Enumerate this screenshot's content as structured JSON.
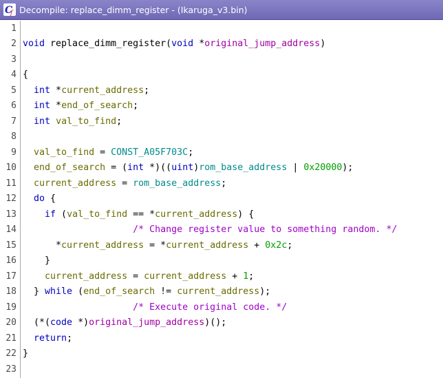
{
  "window": {
    "title": "Decompile: replace_dimm_register -  (Ikaruga_v3.bin)",
    "icon": "ghidra-decompile-icon"
  },
  "colors": {
    "titlebar": "#7a74c0",
    "keyword": "#0000c0",
    "parameter": "#a000a0",
    "local_variable": "#6a6a00",
    "global": "#008a8a",
    "constant": "#00a000",
    "comment": "#a000c8"
  },
  "code": {
    "lines": [
      {
        "num": "1",
        "tokens": []
      },
      {
        "num": "2",
        "tokens": [
          {
            "t": "kw",
            "v": "void"
          },
          {
            "t": "plain",
            "v": " replace_dimm_register("
          },
          {
            "t": "kw",
            "v": "void"
          },
          {
            "t": "plain",
            "v": " *"
          },
          {
            "t": "param",
            "v": "original_jump_address"
          },
          {
            "t": "plain",
            "v": ")"
          }
        ]
      },
      {
        "num": "3",
        "tokens": []
      },
      {
        "num": "4",
        "tokens": [
          {
            "t": "plain",
            "v": "{"
          }
        ]
      },
      {
        "num": "5",
        "tokens": [
          {
            "t": "plain",
            "v": "  "
          },
          {
            "t": "kw",
            "v": "int"
          },
          {
            "t": "plain",
            "v": " *"
          },
          {
            "t": "var",
            "v": "current_address"
          },
          {
            "t": "plain",
            "v": ";"
          }
        ]
      },
      {
        "num": "6",
        "tokens": [
          {
            "t": "plain",
            "v": "  "
          },
          {
            "t": "kw",
            "v": "int"
          },
          {
            "t": "plain",
            "v": " *"
          },
          {
            "t": "var",
            "v": "end_of_search"
          },
          {
            "t": "plain",
            "v": ";"
          }
        ]
      },
      {
        "num": "7",
        "tokens": [
          {
            "t": "plain",
            "v": "  "
          },
          {
            "t": "kw",
            "v": "int"
          },
          {
            "t": "plain",
            "v": " "
          },
          {
            "t": "var",
            "v": "val_to_find"
          },
          {
            "t": "plain",
            "v": ";"
          }
        ]
      },
      {
        "num": "8",
        "tokens": []
      },
      {
        "num": "9",
        "tokens": [
          {
            "t": "plain",
            "v": "  "
          },
          {
            "t": "var",
            "v": "val_to_find"
          },
          {
            "t": "plain",
            "v": " = "
          },
          {
            "t": "glob",
            "v": "CONST_A05F703C"
          },
          {
            "t": "plain",
            "v": ";"
          }
        ]
      },
      {
        "num": "10",
        "tokens": [
          {
            "t": "plain",
            "v": "  "
          },
          {
            "t": "var",
            "v": "end_of_search"
          },
          {
            "t": "plain",
            "v": " = ("
          },
          {
            "t": "kw",
            "v": "int"
          },
          {
            "t": "plain",
            "v": " *)(("
          },
          {
            "t": "kw",
            "v": "uint"
          },
          {
            "t": "plain",
            "v": ")"
          },
          {
            "t": "glob",
            "v": "rom_base_address"
          },
          {
            "t": "plain",
            "v": " | "
          },
          {
            "t": "num",
            "v": "0x20000"
          },
          {
            "t": "plain",
            "v": ");"
          }
        ]
      },
      {
        "num": "11",
        "tokens": [
          {
            "t": "plain",
            "v": "  "
          },
          {
            "t": "var",
            "v": "current_address"
          },
          {
            "t": "plain",
            "v": " = "
          },
          {
            "t": "glob",
            "v": "rom_base_address"
          },
          {
            "t": "plain",
            "v": ";"
          }
        ]
      },
      {
        "num": "12",
        "tokens": [
          {
            "t": "plain",
            "v": "  "
          },
          {
            "t": "kw",
            "v": "do"
          },
          {
            "t": "plain",
            "v": " {"
          }
        ]
      },
      {
        "num": "13",
        "tokens": [
          {
            "t": "plain",
            "v": "    "
          },
          {
            "t": "kw",
            "v": "if"
          },
          {
            "t": "plain",
            "v": " ("
          },
          {
            "t": "var",
            "v": "val_to_find"
          },
          {
            "t": "plain",
            "v": " == *"
          },
          {
            "t": "var",
            "v": "current_address"
          },
          {
            "t": "plain",
            "v": ") {"
          }
        ]
      },
      {
        "num": "14",
        "tokens": [
          {
            "t": "plain",
            "v": "                    "
          },
          {
            "t": "cmt",
            "v": "/* Change register value to something random. */"
          }
        ]
      },
      {
        "num": "15",
        "tokens": [
          {
            "t": "plain",
            "v": "      *"
          },
          {
            "t": "var",
            "v": "current_address"
          },
          {
            "t": "plain",
            "v": " = *"
          },
          {
            "t": "var",
            "v": "current_address"
          },
          {
            "t": "plain",
            "v": " + "
          },
          {
            "t": "num",
            "v": "0x2c"
          },
          {
            "t": "plain",
            "v": ";"
          }
        ]
      },
      {
        "num": "16",
        "tokens": [
          {
            "t": "plain",
            "v": "    }"
          }
        ]
      },
      {
        "num": "17",
        "tokens": [
          {
            "t": "plain",
            "v": "    "
          },
          {
            "t": "var",
            "v": "current_address"
          },
          {
            "t": "plain",
            "v": " = "
          },
          {
            "t": "var",
            "v": "current_address"
          },
          {
            "t": "plain",
            "v": " + "
          },
          {
            "t": "num",
            "v": "1"
          },
          {
            "t": "plain",
            "v": ";"
          }
        ]
      },
      {
        "num": "18",
        "tokens": [
          {
            "t": "plain",
            "v": "  } "
          },
          {
            "t": "kw",
            "v": "while"
          },
          {
            "t": "plain",
            "v": " ("
          },
          {
            "t": "var",
            "v": "end_of_search"
          },
          {
            "t": "plain",
            "v": " != "
          },
          {
            "t": "var",
            "v": "current_address"
          },
          {
            "t": "plain",
            "v": ");"
          }
        ]
      },
      {
        "num": "19",
        "tokens": [
          {
            "t": "plain",
            "v": "                    "
          },
          {
            "t": "cmt",
            "v": "/* Execute original code. */"
          }
        ]
      },
      {
        "num": "20",
        "tokens": [
          {
            "t": "plain",
            "v": "  (*("
          },
          {
            "t": "kw",
            "v": "code"
          },
          {
            "t": "plain",
            "v": " *)"
          },
          {
            "t": "param",
            "v": "original_jump_address"
          },
          {
            "t": "plain",
            "v": ")();"
          }
        ]
      },
      {
        "num": "21",
        "tokens": [
          {
            "t": "plain",
            "v": "  "
          },
          {
            "t": "kw",
            "v": "return"
          },
          {
            "t": "plain",
            "v": ";"
          }
        ]
      },
      {
        "num": "22",
        "tokens": [
          {
            "t": "plain",
            "v": "}"
          }
        ]
      },
      {
        "num": "23",
        "tokens": []
      }
    ]
  }
}
